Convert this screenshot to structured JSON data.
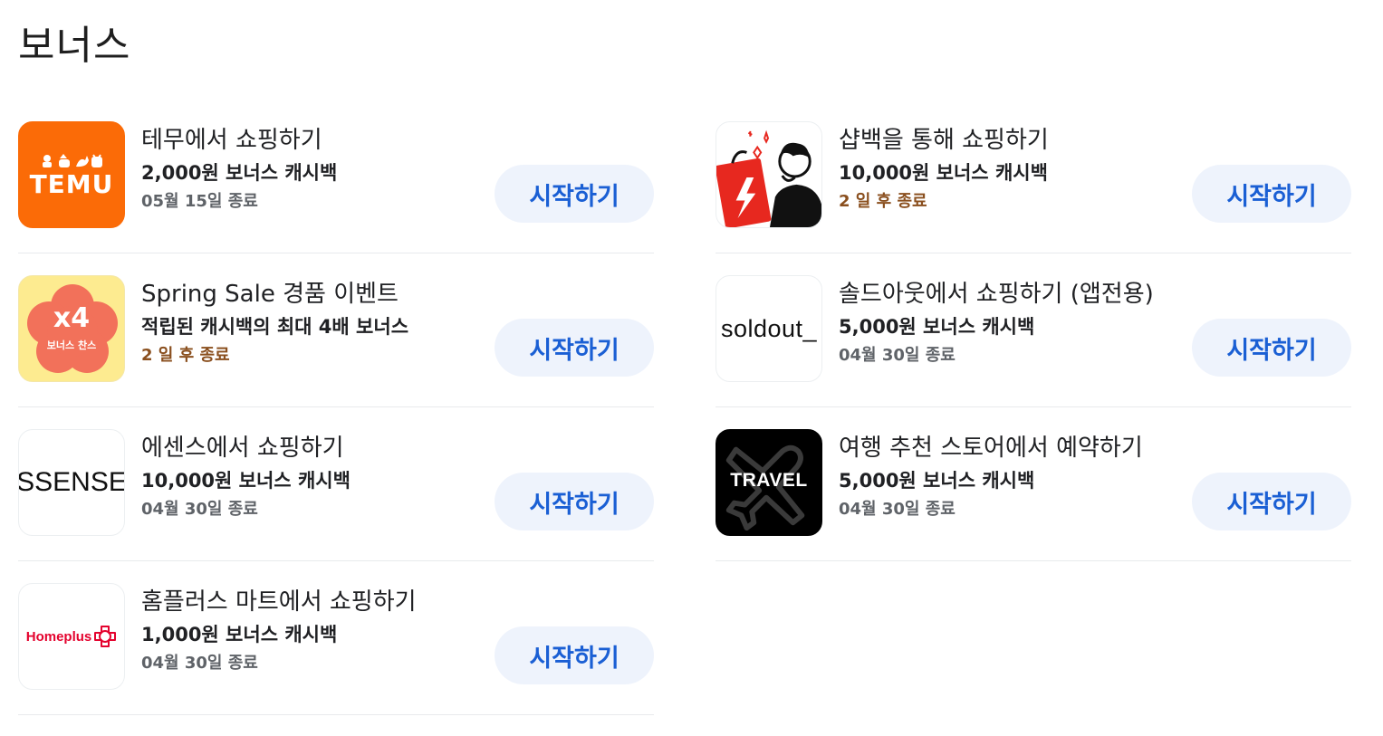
{
  "page": {
    "title": "보너스"
  },
  "bonuses": [
    {
      "id": "temu",
      "title": "테무에서 쇼핑하기",
      "subtitle": "2,000원 보너스 캐시백",
      "expiry": "05월 15일 종료",
      "expiry_urgent": false,
      "button_label": "시작하기",
      "logo": {
        "word": "TEMU",
        "color": "#fb6b07",
        "icons": "ᴥ ᴗ ᴥ"
      }
    },
    {
      "id": "shopback",
      "title": "샵백을 통해 쇼핑하기",
      "subtitle": "10,000원 보너스 캐시백",
      "expiry": "2 일 후 종료",
      "expiry_urgent": true,
      "button_label": "시작하기",
      "logo": {
        "icon": "shopback-shopper-icon",
        "color": "#e7281f"
      }
    },
    {
      "id": "spring-sale",
      "title": "Spring Sale 경품 이벤트",
      "subtitle": "적립된 캐시백의 최대 4배 보너스",
      "expiry": "2 일 후 종료",
      "expiry_urgent": true,
      "button_label": "시작하기",
      "logo": {
        "big": "x4",
        "small": "보너스 찬스",
        "color": "#f2715a",
        "background": "#fdeb90"
      }
    },
    {
      "id": "soldout",
      "title": "솔드아웃에서 쇼핑하기 (앱전용)",
      "subtitle": "5,000원 보너스 캐시백",
      "expiry": "04월 30일 종료",
      "expiry_urgent": false,
      "button_label": "시작하기",
      "logo": {
        "word": "soldout_"
      }
    },
    {
      "id": "ssense",
      "title": "에센스에서 쇼핑하기",
      "subtitle": "10,000원 보너스 캐시백",
      "expiry": "04월 30일 종료",
      "expiry_urgent": false,
      "button_label": "시작하기",
      "logo": {
        "word": "SSENSE"
      }
    },
    {
      "id": "travel",
      "title": "여행 추천 스토어에서 예약하기",
      "subtitle": "5,000원 보너스 캐시백",
      "expiry": "04월 30일 종료",
      "expiry_urgent": false,
      "button_label": "시작하기",
      "logo": {
        "word": "TRAVEL",
        "icon": "airplane-icon"
      }
    },
    {
      "id": "homeplus",
      "title": "홈플러스 마트에서 쇼핑하기",
      "subtitle": "1,000원 보너스 캐시백",
      "expiry": "04월 30일 종료",
      "expiry_urgent": false,
      "button_label": "시작하기",
      "logo": {
        "word": "Homeplus",
        "color": "#e4032e"
      }
    }
  ],
  "colors": {
    "button_bg": "#eef3fc",
    "button_text": "#1a5fd4",
    "urgent_text": "#8a4f1e",
    "date_text": "#5f6368"
  }
}
